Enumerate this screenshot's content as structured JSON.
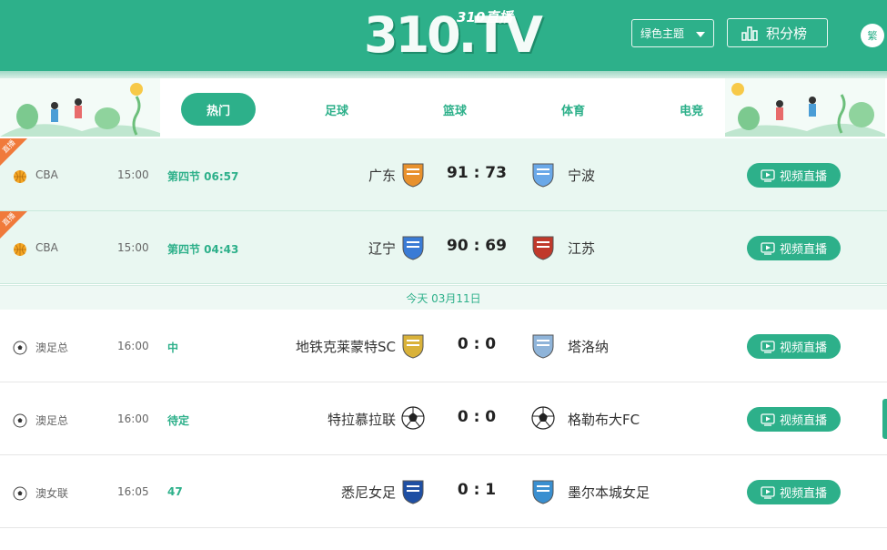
{
  "header": {
    "logo_main": "310.TV",
    "logo_sub": "310直播",
    "theme_label": "绿色主题",
    "rank_label": "积分榜",
    "lang_label": "繁"
  },
  "tabs": [
    "热门",
    "足球",
    "篮球",
    "体育",
    "电竞"
  ],
  "hot_tag": "直播",
  "date_bar": "今天 03月11日",
  "live_label": "视频直播",
  "colors": {
    "brand": "#2db08a",
    "hot_tag": "#f07a3b"
  },
  "matches": [
    {
      "league": "CBA",
      "sport": "basketball",
      "time": "15:00",
      "status": "第四节 06:57",
      "home": "广东",
      "score": "91 : 73",
      "away": "宁波",
      "hot": true
    },
    {
      "league": "CBA",
      "sport": "basketball",
      "time": "15:00",
      "status": "第四节 04:43",
      "home": "辽宁",
      "score": "90 : 69",
      "away": "江苏",
      "hot": true
    },
    {
      "league": "澳足总",
      "sport": "soccer",
      "time": "16:00",
      "status": "中",
      "home": "地铁克莱蒙特SC",
      "score": "0 : 0",
      "away": "塔洛纳",
      "hot": false
    },
    {
      "league": "澳足总",
      "sport": "soccer",
      "time": "16:00",
      "status": "待定",
      "home": "特拉慕拉联",
      "score": "0 : 0",
      "away": "格勒布大FC",
      "hot": false
    },
    {
      "league": "澳女联",
      "sport": "soccer",
      "time": "16:05",
      "status": "47",
      "home": "悉尼女足",
      "score": "0 : 1",
      "away": "墨尔本城女足",
      "hot": false
    }
  ]
}
